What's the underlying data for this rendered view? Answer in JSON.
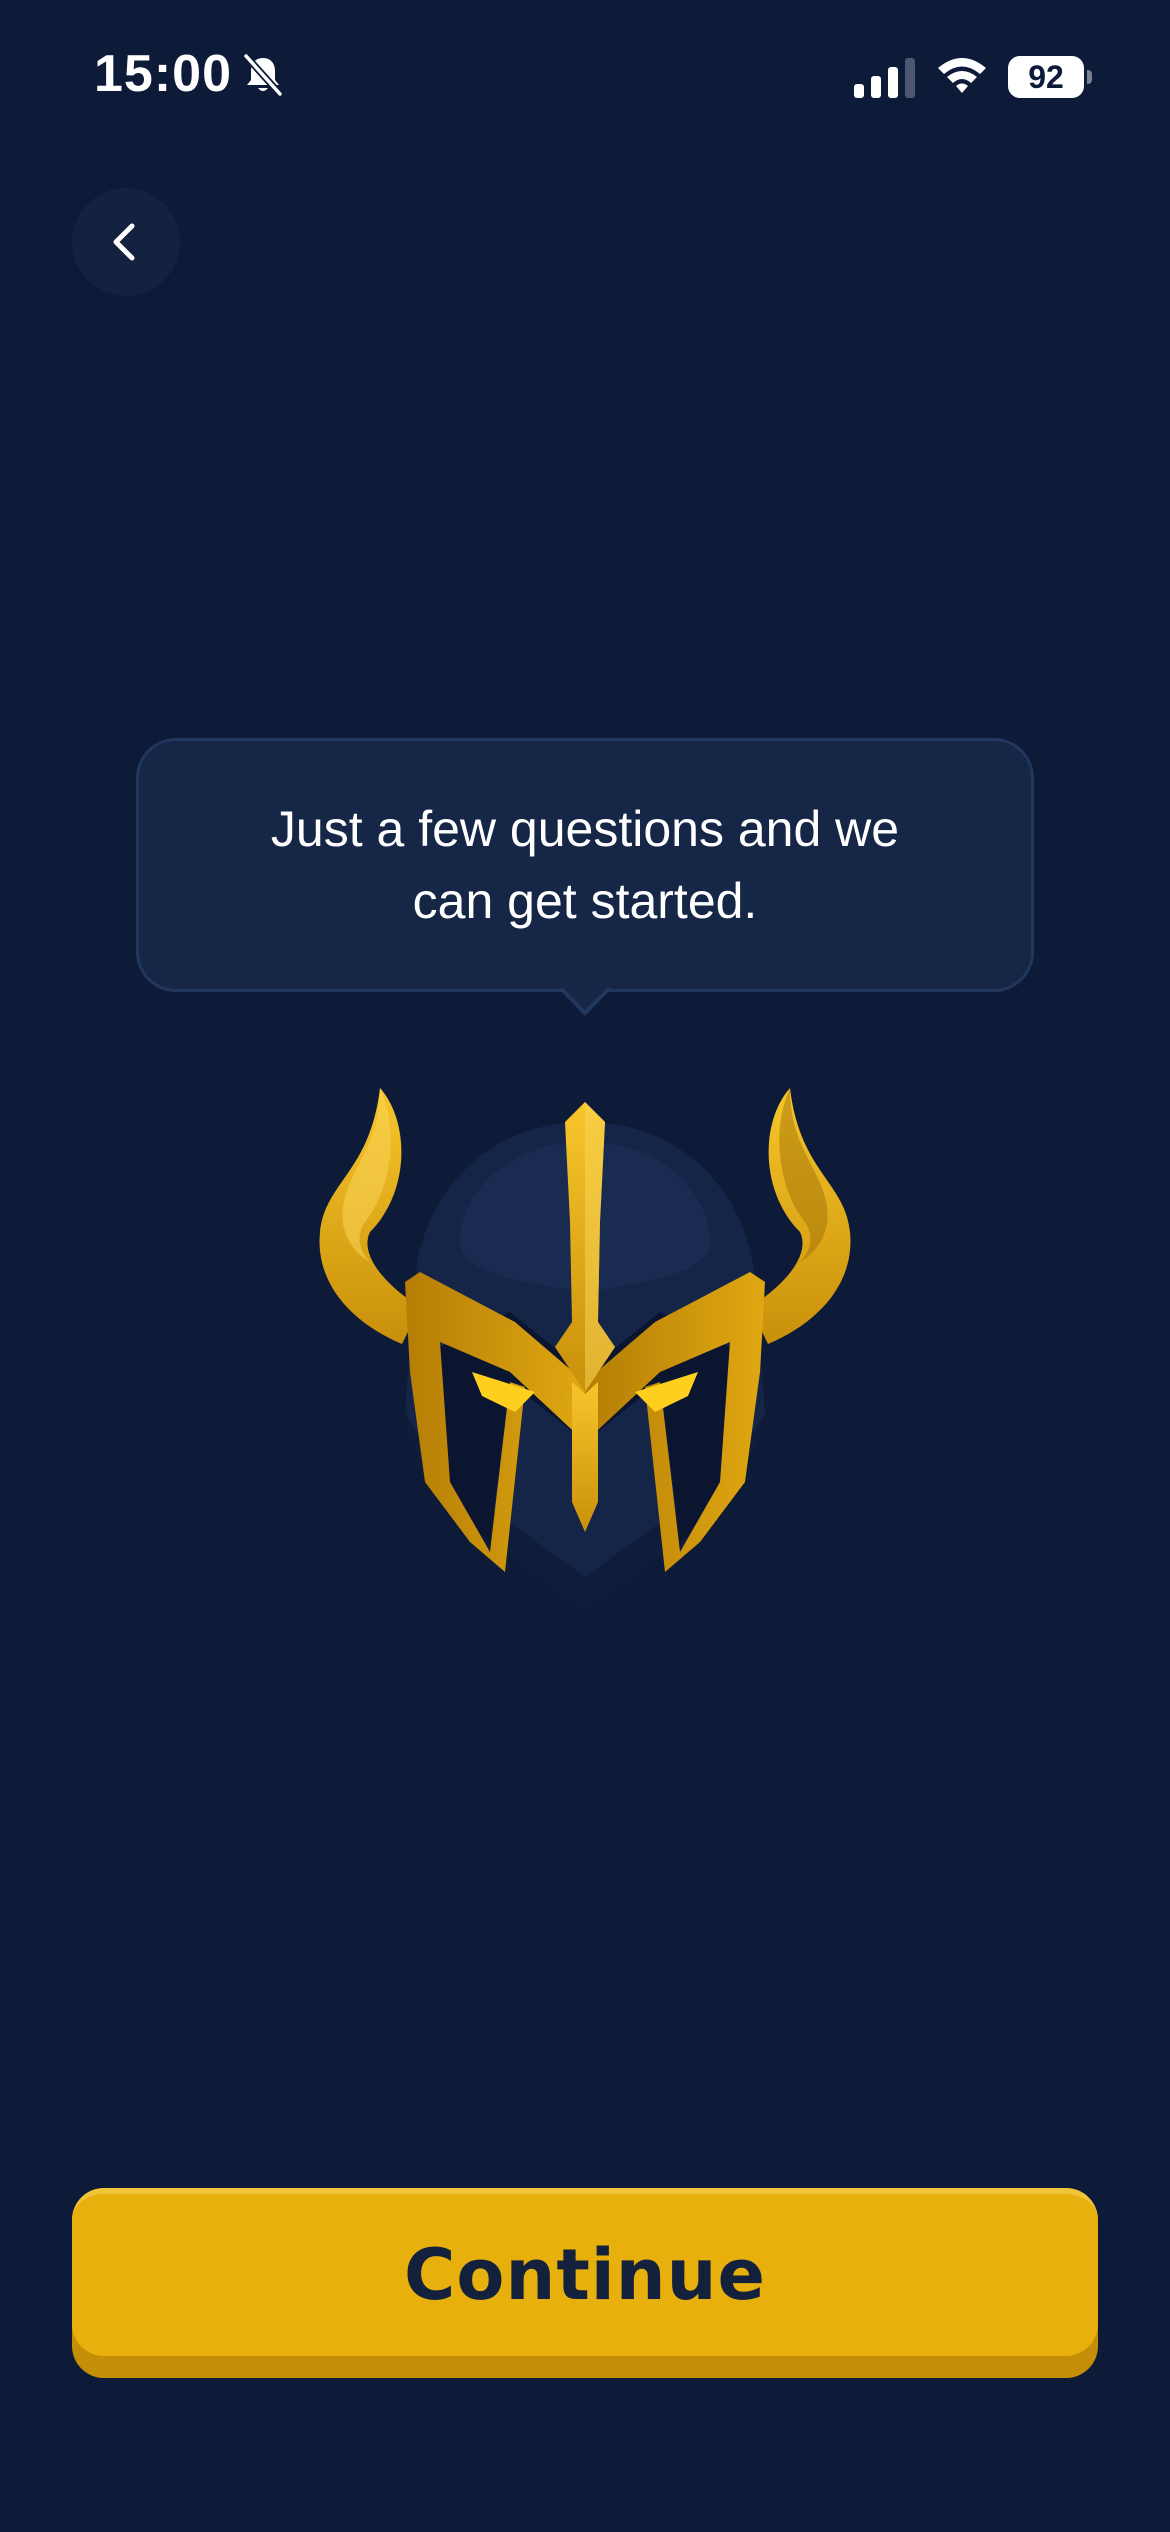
{
  "status_bar": {
    "time": "15:00",
    "battery": "92",
    "icons": [
      "bell-slash-icon",
      "signal-icon",
      "wifi-icon",
      "battery-icon"
    ]
  },
  "navigation": {
    "back_icon": "chevron-left-icon"
  },
  "bubble": {
    "text": "Just a few questions and we can get started."
  },
  "mascot": {
    "icon": "horned-helmet-mascot"
  },
  "footer": {
    "continue_label": "Continue"
  },
  "colors": {
    "background": "#0d1a38",
    "accent": "#e8b00d",
    "bubble": "#162646",
    "text_dark": "#14213d"
  }
}
